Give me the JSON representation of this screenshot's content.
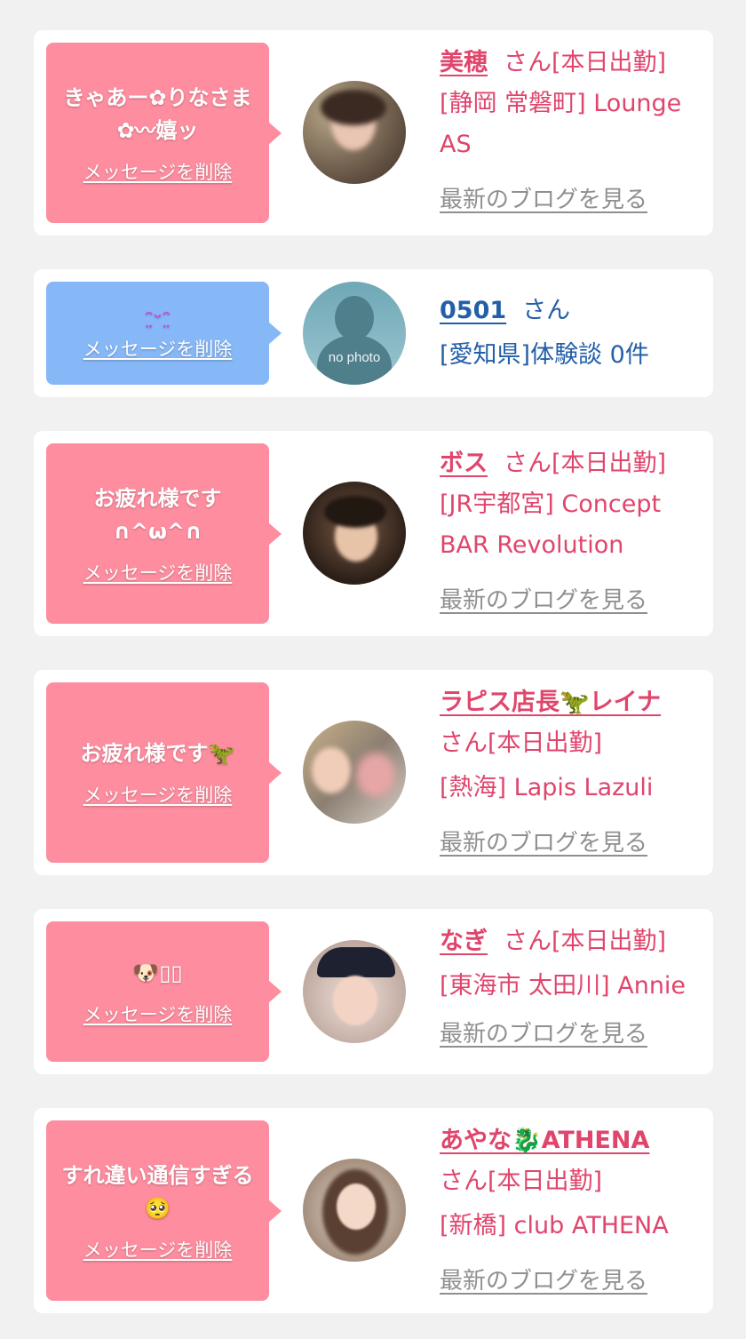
{
  "delete_label": "メッセージを削除",
  "blog_label": "最新のブログを見る",
  "cards": [
    {
      "message": "きゃあー✿りなさま✿〰嬉ッ",
      "name": "美穂",
      "suffix": "さん[本日出勤]",
      "shop": "[静岡 常磐町] Lounge AS"
    },
    {
      "message": "ᵔ̤ᵕᵔ̤",
      "name": "0501",
      "suffix": "さん",
      "shop": "[愛知県]体験談 0件",
      "avatar_text": "no photo"
    },
    {
      "message": "お疲れ様です ∩^ω^∩",
      "name": "ボス",
      "suffix": "さん[本日出勤]",
      "shop": "[JR宇都宮] Concept BAR Revolution"
    },
    {
      "message": "お疲れ様です🦖",
      "name": "ラピス店長🦖レイナ",
      "suffix": "さん[本日出勤]",
      "shop": "[熱海] Lapis Lazuli"
    },
    {
      "message": "🐶▯▯",
      "name": "なぎ",
      "suffix": "さん[本日出勤]",
      "shop": "[東海市 太田川] Annie"
    },
    {
      "message": "すれ違い通信すぎる🥺",
      "name": "あやな🐉ATHENA",
      "suffix": "さん[本日出勤]",
      "shop": "[新橋] club ATHENA"
    }
  ],
  "colors": {
    "bubble_pink": "#fd8d9f",
    "bubble_blue": "#86b7f7",
    "name_pink": "#e0456c",
    "name_blue": "#235fa8",
    "link_gray": "#8f8f8f"
  }
}
